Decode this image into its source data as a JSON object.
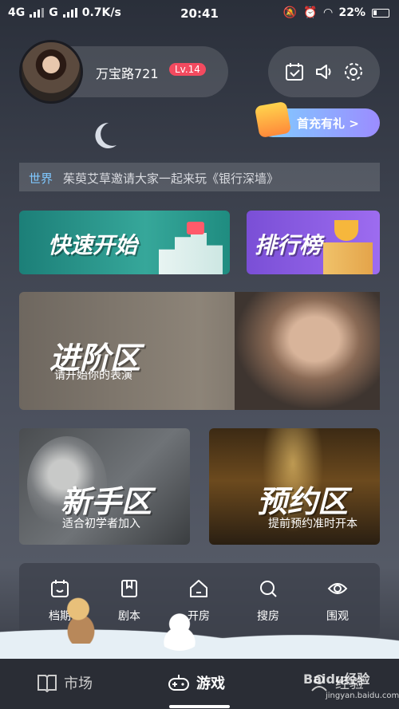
{
  "status_bar": {
    "net1": "4G",
    "net2": "G",
    "speed": "0.7K/s",
    "time": "20:41",
    "battery": "22%"
  },
  "profile": {
    "username": "万宝路721",
    "level": "Lv.14"
  },
  "top_icons": [
    "calendar-check-icon",
    "speaker-icon",
    "gear-icon"
  ],
  "promo": {
    "label": "首充有礼 >"
  },
  "ticker": {
    "channel": "世界",
    "message": "茱萸艾草邀请大家一起来玩《银行深墙》"
  },
  "cards": {
    "quick": {
      "title": "快速开始"
    },
    "rank": {
      "title": "排行榜"
    },
    "advanced": {
      "title": "进阶区",
      "subtitle": "请开始你的表演"
    },
    "newbie": {
      "title": "新手区",
      "subtitle": "适合初学者加入"
    },
    "reserve": {
      "title": "预约区",
      "subtitle": "提前预约准时开本"
    }
  },
  "functions": [
    {
      "label": "档期",
      "icon": "schedule-icon"
    },
    {
      "label": "剧本",
      "icon": "script-icon"
    },
    {
      "label": "开房",
      "icon": "house-icon"
    },
    {
      "label": "搜房",
      "icon": "search-icon"
    },
    {
      "label": "围观",
      "icon": "eye-icon"
    }
  ],
  "bottom_nav": [
    {
      "label": "市场",
      "icon": "book-icon"
    },
    {
      "label": "游戏",
      "icon": "gamepad-icon",
      "active": true
    },
    {
      "label": "经验",
      "icon": "user-icon"
    }
  ],
  "watermark": {
    "brand": "Baidu经验",
    "url": "jingyan.baidu.com"
  },
  "colors": {
    "level_badge": "#f34a5f",
    "ticker_channel": "#7fc8ff",
    "quick_card": "#36a79a",
    "rank_card": "#9d6cf0"
  }
}
